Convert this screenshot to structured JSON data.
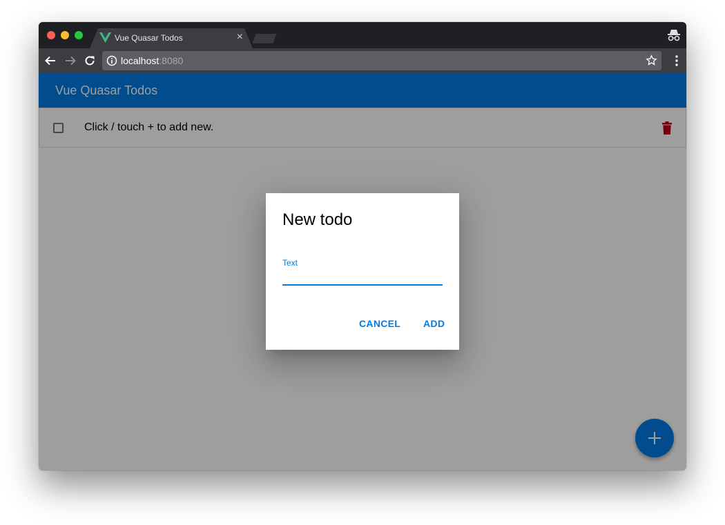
{
  "browser": {
    "tab_title": "Vue Quasar Todos",
    "tab_close": "×",
    "url_host": "localhost",
    "url_port": ":8080"
  },
  "app": {
    "title": "Vue Quasar Todos",
    "todos": [
      {
        "text": "Click / touch + to add new.",
        "done": false
      }
    ],
    "fab_label": "+"
  },
  "dialog": {
    "title": "New todo",
    "field_label": "Text",
    "field_value": "",
    "cancel_label": "CANCEL",
    "add_label": "ADD"
  },
  "colors": {
    "primary": "#027be3",
    "danger": "#c10015",
    "chrome_dark": "#1f2023",
    "chrome_toolbar": "#3c3d41"
  },
  "icons": [
    "vue-logo-icon",
    "incognito-icon",
    "back-arrow-icon",
    "forward-arrow-icon",
    "reload-icon",
    "info-icon",
    "bookmark-star-icon",
    "more-vert-icon",
    "checkbox-icon",
    "trash-icon",
    "plus-icon"
  ]
}
